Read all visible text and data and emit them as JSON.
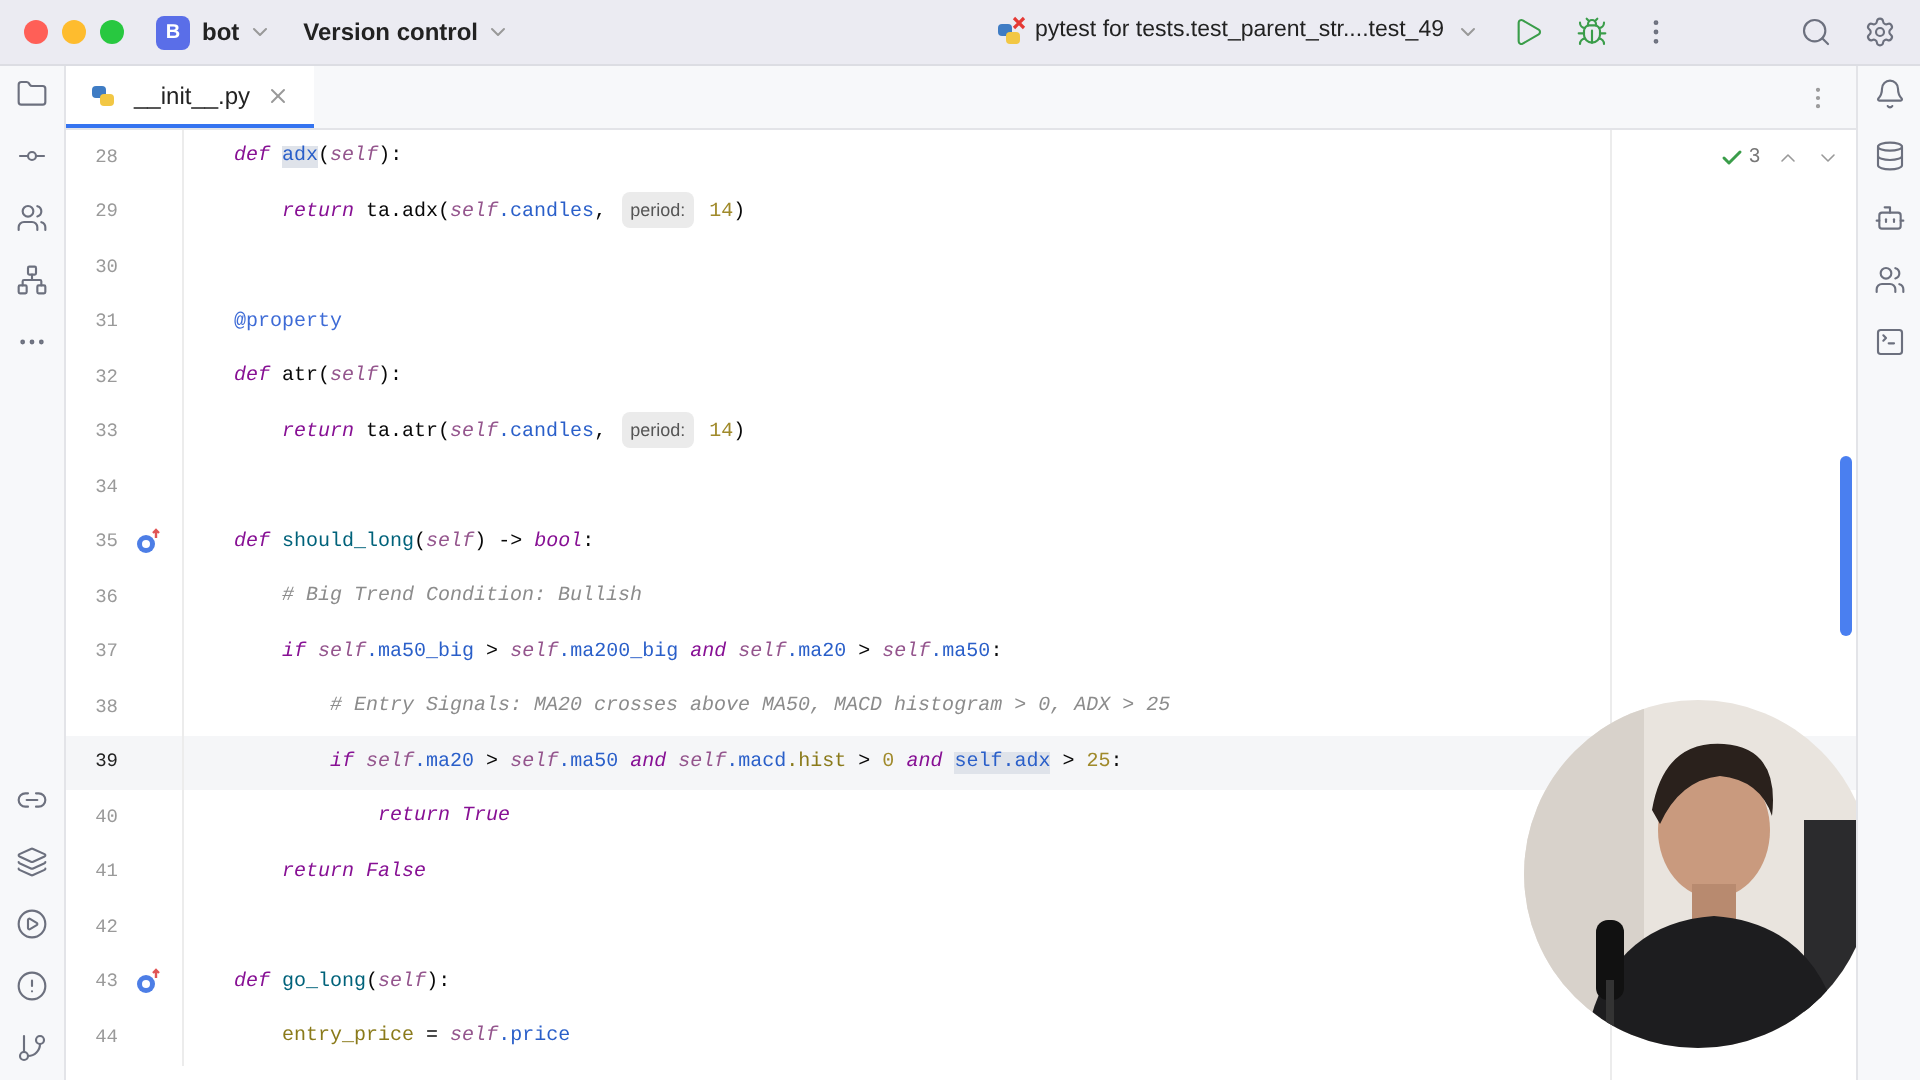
{
  "title_bar": {
    "project_initial": "B",
    "project": "bot",
    "vcs": "Version control",
    "run_config": "pytest for tests.test_parent_str....test_49"
  },
  "tabs": [
    {
      "label": "__init__.py",
      "selected": true
    }
  ],
  "inspection": {
    "count": "3"
  },
  "editor": {
    "lines": [
      {
        "number": "28",
        "current": false,
        "overridden": false,
        "tokens": [
          {
            "kind": "kw",
            "text": "    def "
          },
          {
            "kind": "ref",
            "text": "adx"
          },
          {
            "kind": "plain",
            "text": "("
          },
          {
            "kind": "self",
            "text": "self"
          },
          {
            "kind": "plain",
            "text": "):"
          }
        ]
      },
      {
        "number": "29",
        "current": false,
        "overridden": false,
        "tokens": [
          {
            "kind": "kw",
            "text": "        return"
          },
          {
            "kind": "plain",
            "text": " ta.adx("
          },
          {
            "kind": "self",
            "text": "self"
          },
          {
            "kind": "attr",
            "text": ".candles"
          },
          {
            "kind": "plain",
            "text": ", "
          },
          {
            "kind": "hint",
            "text": "period:"
          },
          {
            "kind": "num",
            "text": " 14"
          },
          {
            "kind": "plain",
            "text": ")"
          }
        ]
      },
      {
        "number": "30",
        "current": false,
        "overridden": false
      },
      {
        "number": "31",
        "current": false,
        "overridden": false,
        "tokens": [
          {
            "kind": "deco",
            "text": "    @property"
          }
        ]
      },
      {
        "number": "32",
        "current": false,
        "overridden": false,
        "tokens": [
          {
            "kind": "kw",
            "text": "    def"
          },
          {
            "kind": "plain",
            "text": " atr("
          },
          {
            "kind": "self",
            "text": "self"
          },
          {
            "kind": "plain",
            "text": "):"
          }
        ]
      },
      {
        "number": "33",
        "current": false,
        "overridden": false,
        "tokens": [
          {
            "kind": "kw",
            "text": "        return"
          },
          {
            "kind": "plain",
            "text": " ta.atr("
          },
          {
            "kind": "self",
            "text": "self"
          },
          {
            "kind": "attr",
            "text": ".candles"
          },
          {
            "kind": "plain",
            "text": ", "
          },
          {
            "kind": "hint",
            "text": "period:"
          },
          {
            "kind": "num",
            "text": " 14"
          },
          {
            "kind": "plain",
            "text": ")"
          }
        ]
      },
      {
        "number": "34",
        "current": false,
        "overridden": false
      },
      {
        "number": "35",
        "current": false,
        "overridden": true,
        "tokens": [
          {
            "kind": "kw",
            "text": "    def "
          },
          {
            "kind": "fn",
            "text": "should_long"
          },
          {
            "kind": "plain",
            "text": "("
          },
          {
            "kind": "self",
            "text": "self"
          },
          {
            "kind": "plain",
            "text": ") -> "
          },
          {
            "kind": "builtin",
            "text": "bool"
          },
          {
            "kind": "plain",
            "text": ":"
          }
        ]
      },
      {
        "number": "36",
        "current": false,
        "overridden": false,
        "tokens": [
          {
            "kind": "comment",
            "text": "        # Big Trend Condition: Bullish"
          }
        ]
      },
      {
        "number": "37",
        "current": false,
        "overridden": false,
        "tokens": [
          {
            "kind": "kw",
            "text": "        if "
          },
          {
            "kind": "self",
            "text": "self"
          },
          {
            "kind": "attr",
            "text": ".ma50_big"
          },
          {
            "kind": "plain",
            "text": " > "
          },
          {
            "kind": "self",
            "text": "self"
          },
          {
            "kind": "attr",
            "text": ".ma200_big"
          },
          {
            "kind": "kw",
            "text": " and "
          },
          {
            "kind": "self",
            "text": "self"
          },
          {
            "kind": "attr",
            "text": ".ma20"
          },
          {
            "kind": "plain",
            "text": " > "
          },
          {
            "kind": "self",
            "text": "self"
          },
          {
            "kind": "attr",
            "text": ".ma50"
          },
          {
            "kind": "plain",
            "text": ":"
          }
        ]
      },
      {
        "number": "38",
        "current": false,
        "overridden": false,
        "tokens": [
          {
            "kind": "comment",
            "text": "            # Entry Signals: MA20 crosses above MA50, MACD histogram > 0, ADX > 25"
          }
        ]
      },
      {
        "number": "39",
        "current": true,
        "overridden": false,
        "tokens": [
          {
            "kind": "kw",
            "text": "            if "
          },
          {
            "kind": "self",
            "text": "self"
          },
          {
            "kind": "attr",
            "text": ".ma20"
          },
          {
            "kind": "plain",
            "text": " > "
          },
          {
            "kind": "self",
            "text": "self"
          },
          {
            "kind": "attr",
            "text": ".ma50"
          },
          {
            "kind": "kw",
            "text": " and "
          },
          {
            "kind": "self",
            "text": "self"
          },
          {
            "kind": "attr",
            "text": ".macd"
          },
          {
            "kind": "var",
            "text": ".hist"
          },
          {
            "kind": "plain",
            "text": " > "
          },
          {
            "kind": "num",
            "text": "0"
          },
          {
            "kind": "kw",
            "text": " and "
          },
          {
            "kind": "ref",
            "text": "self.adx"
          },
          {
            "kind": "plain",
            "text": " > "
          },
          {
            "kind": "num",
            "text": "25"
          },
          {
            "kind": "plain",
            "text": ":"
          }
        ]
      },
      {
        "number": "40",
        "current": false,
        "overridden": false,
        "tokens": [
          {
            "kind": "kw",
            "text": "                return "
          },
          {
            "kind": "builtin",
            "text": "True"
          }
        ]
      },
      {
        "number": "41",
        "current": false,
        "overridden": false,
        "tokens": [
          {
            "kind": "kw",
            "text": "        return "
          },
          {
            "kind": "builtin",
            "text": "False"
          }
        ]
      },
      {
        "number": "42",
        "current": false,
        "overridden": false
      },
      {
        "number": "43",
        "current": false,
        "overridden": true,
        "tokens": [
          {
            "kind": "kw",
            "text": "    def "
          },
          {
            "kind": "fn",
            "text": "go_long"
          },
          {
            "kind": "plain",
            "text": "("
          },
          {
            "kind": "self",
            "text": "self"
          },
          {
            "kind": "plain",
            "text": "):"
          }
        ]
      },
      {
        "number": "44",
        "current": false,
        "overridden": false,
        "tokens": [
          {
            "kind": "var",
            "text": "        entry_price"
          },
          {
            "kind": "plain",
            "text": " = "
          },
          {
            "kind": "self",
            "text": "self"
          },
          {
            "kind": "attr",
            "text": ".price"
          }
        ]
      }
    ]
  }
}
